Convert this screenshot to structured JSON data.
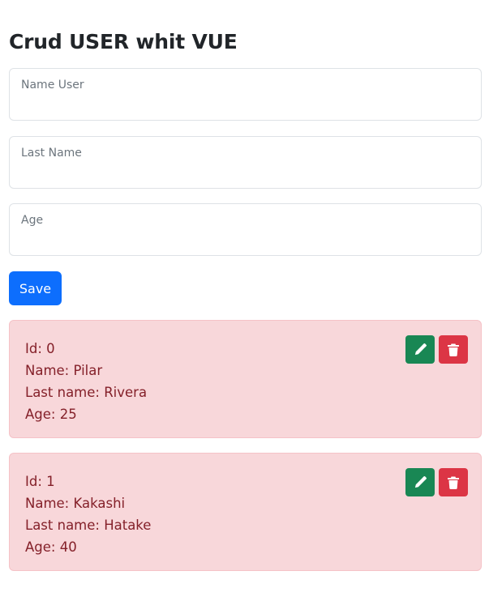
{
  "header": {
    "title": "Crud USER whit VUE"
  },
  "form": {
    "fields": [
      {
        "label": "Name User",
        "value": ""
      },
      {
        "label": "Last Name",
        "value": ""
      },
      {
        "label": "Age",
        "value": ""
      }
    ],
    "save_label": "Save"
  },
  "users": [
    {
      "id_line": "Id: 0",
      "name_line": "Name: Pilar",
      "last_name_line": "Last name: Rivera",
      "age_line": "Age: 25"
    },
    {
      "id_line": "Id: 1",
      "name_line": "Name: Kakashi",
      "last_name_line": "Last name: Hatake",
      "age_line": "Age: 40"
    }
  ],
  "actions": {
    "edit_icon": "pencil-icon",
    "delete_icon": "trash-icon"
  },
  "colors": {
    "primary": "#0d6efd",
    "success": "#198754",
    "danger": "#dc3545",
    "card_background": "#f8d7da",
    "card_text": "#842029"
  }
}
